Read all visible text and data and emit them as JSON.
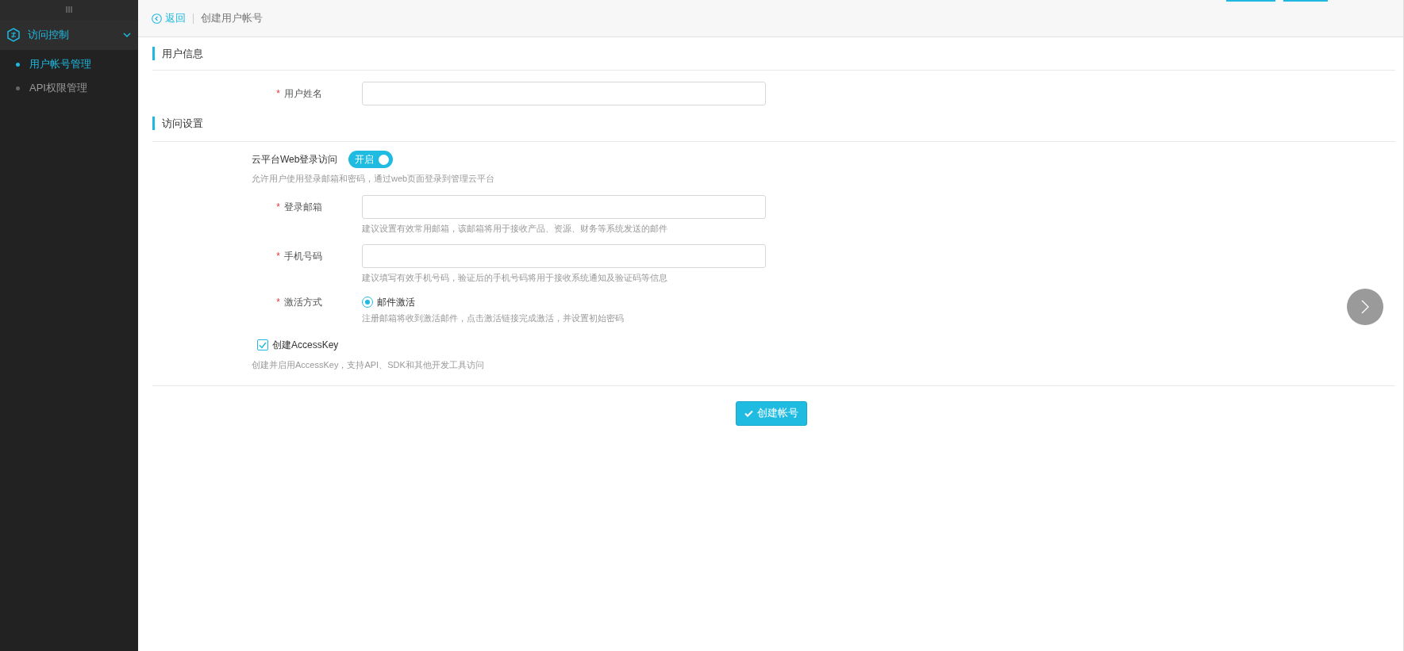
{
  "sidebar": {
    "toggle": "III",
    "group": {
      "label": "访问控制",
      "expanded": true
    },
    "items": [
      {
        "label": "用户帐号管理",
        "selected": true
      },
      {
        "label": "API权限管理",
        "selected": false
      }
    ]
  },
  "header": {
    "back": "返回",
    "title": "创建用户帐号"
  },
  "sections": [
    {
      "title": "用户信息"
    },
    {
      "title": "访问设置"
    }
  ],
  "username": {
    "label": "用户姓名",
    "required_mark": "*"
  },
  "web_login": {
    "label": "云平台Web登录访问",
    "toggle": {
      "label": "开启",
      "on": true
    },
    "description": "允许用户使用登录邮箱和密码，通过web页面登录到管理云平台"
  },
  "fields": [
    {
      "label": "登录邮箱",
      "required_mark": "*",
      "hint": "建议设置有效常用邮箱，该邮箱将用于接收产品、资源、财务等系统发送的邮件"
    },
    {
      "label": "手机号码",
      "required_mark": "*",
      "hint": "建议填写有效手机号码，验证后的手机号码将用于接收系统通知及验证码等信息"
    }
  ],
  "activation": {
    "label": "激活方式",
    "required_mark": "*",
    "options": [
      {
        "label": "邮件激活",
        "selected": true
      }
    ],
    "hint": "注册邮箱将收到激活邮件，点击激活链接完成激活，并设置初始密码"
  },
  "access_key": {
    "label": "创建AccessKey",
    "checked": true,
    "description": "创建并启用AccessKey，支持API、SDK和其他开发工具访问"
  },
  "submit": "创建帐号"
}
